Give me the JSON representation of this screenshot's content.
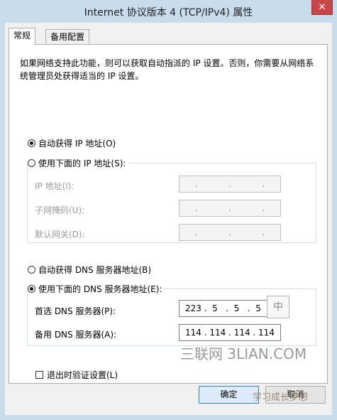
{
  "window": {
    "title": "Internet 协议版本 4 (TCP/IPv4) 属性",
    "close_glyph": "✕"
  },
  "tabs": [
    {
      "label": "常规"
    },
    {
      "label": "备用配置"
    }
  ],
  "description": "如果网络支持此功能，则可以获取自动指派的 IP 设置。否则，你需要从网络系统管理员处获得适当的 IP 设置。",
  "ip": {
    "auto_label": "自动获得 IP 地址(O)",
    "manual_label": "使用下面的 IP 地址(S):",
    "address_label": "IP 地址(I):",
    "mask_label": "子网掩码(U):",
    "gateway_label": "默认网关(D):",
    "empty_dot": "."
  },
  "dns": {
    "auto_label": "自动获得 DNS 服务器地址(B)",
    "manual_label": "使用下面的 DNS 服务器地址(E):",
    "preferred_label": "首选 DNS 服务器(P):",
    "preferred_value": "223 .  5   .  5   .  5",
    "alternate_label": "备用 DNS 服务器(A):",
    "alternate_value": "114 . 114 . 114 . 114"
  },
  "validate_label": "退出时验证设置(L)",
  "buttons": {
    "ok": "确定",
    "cancel": "取消"
  },
  "ime_glyph": "中",
  "watermarks": {
    "site": "三联网 3LIAN.COM",
    "stamp": "学习成长梦想"
  }
}
